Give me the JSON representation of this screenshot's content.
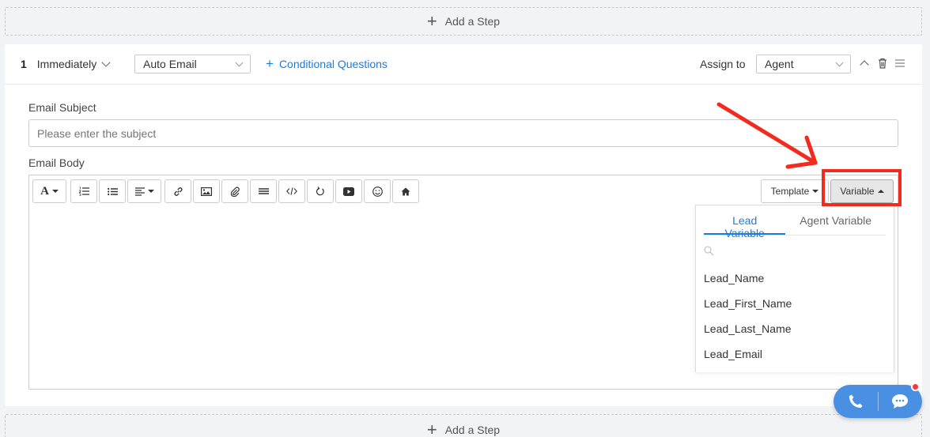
{
  "add_step": {
    "label": "Add a Step"
  },
  "step": {
    "number": "1",
    "timing": "Immediately",
    "type": "Auto Email",
    "conditional": "Conditional Questions",
    "assign_label": "Assign to",
    "assignee": "Agent"
  },
  "email": {
    "subject_label": "Email Subject",
    "subject_placeholder": "Please enter the subject",
    "body_label": "Email Body"
  },
  "toolbar": {
    "icons": [
      "font-icon",
      "ordered-list-icon",
      "unordered-list-icon",
      "align-icon",
      "link-icon",
      "image-icon",
      "attachment-icon",
      "horizontal-rule-icon",
      "code-icon",
      "undo-icon",
      "video-icon",
      "emoji-icon",
      "home-icon"
    ],
    "template_label": "Template",
    "variable_label": "Variable"
  },
  "variable_dropdown": {
    "tabs": [
      "Lead Variable",
      "Agent Variable"
    ],
    "active_tab": "Lead Variable",
    "items": [
      "Lead_Name",
      "Lead_First_Name",
      "Lead_Last_Name",
      "Lead_Email"
    ]
  },
  "colors": {
    "accent": "#1c7be0",
    "highlight": "#f22b20",
    "fab": "#4a90e2",
    "notification": "#ee3b3b"
  }
}
